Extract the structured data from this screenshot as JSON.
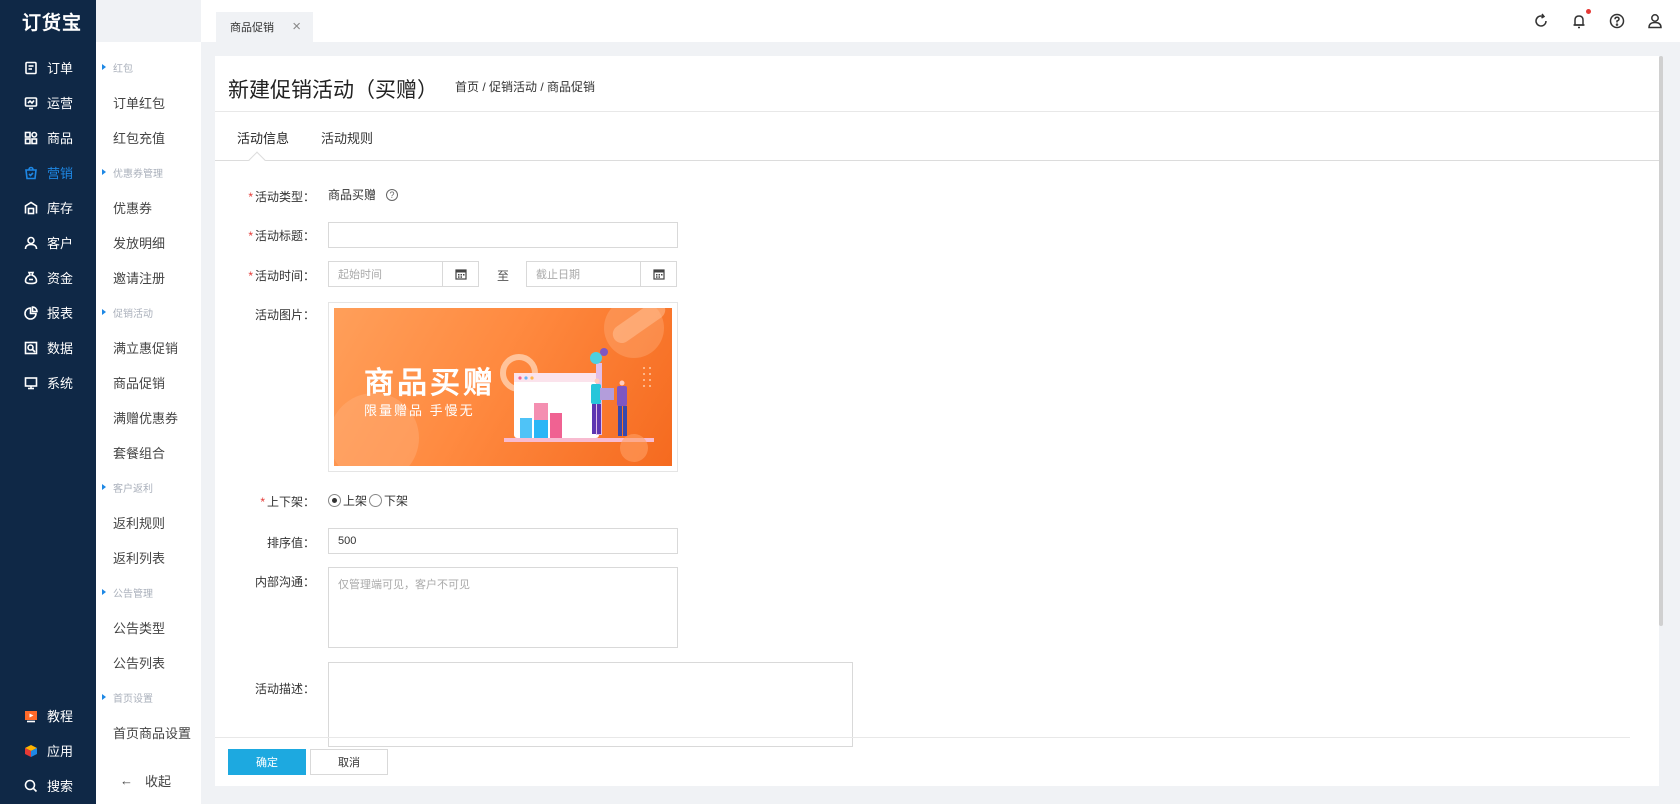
{
  "app": {
    "logo": "订货宝"
  },
  "nav": {
    "items": [
      {
        "label": "订单",
        "icon": "order-icon"
      },
      {
        "label": "运营",
        "icon": "operation-icon"
      },
      {
        "label": "商品",
        "icon": "goods-icon"
      },
      {
        "label": "营销",
        "icon": "marketing-icon",
        "active": true
      },
      {
        "label": "库存",
        "icon": "warehouse-icon"
      },
      {
        "label": "客户",
        "icon": "customer-icon"
      },
      {
        "label": "资金",
        "icon": "money-icon"
      },
      {
        "label": "报表",
        "icon": "report-icon"
      },
      {
        "label": "数据",
        "icon": "data-icon"
      },
      {
        "label": "系统",
        "icon": "system-icon"
      }
    ],
    "bottom": [
      {
        "label": "教程",
        "icon": "tutorial-icon"
      },
      {
        "label": "应用",
        "icon": "app-icon"
      },
      {
        "label": "搜索",
        "icon": "search-icon"
      }
    ]
  },
  "subnav": {
    "groups": [
      {
        "head": "红包",
        "items": [
          "订单红包",
          "红包充值"
        ]
      },
      {
        "head": "优惠券管理",
        "items": [
          "优惠券",
          "发放明细",
          "邀请注册"
        ]
      },
      {
        "head": "促销活动",
        "items": [
          "满立惠促销",
          "商品促销",
          "满赠优惠券",
          "套餐组合"
        ]
      },
      {
        "head": "客户返利",
        "items": [
          "返利规则",
          "返利列表"
        ]
      },
      {
        "head": "公告管理",
        "items": [
          "公告类型",
          "公告列表"
        ]
      },
      {
        "head": "首页设置",
        "items": [
          "首页商品设置"
        ]
      }
    ],
    "collapse_label": "收起"
  },
  "topbar": {
    "tab_label": "商品促销"
  },
  "page": {
    "title": "新建促销活动（买赠）",
    "breadcrumb": "首页 / 促销活动 / 商品促销",
    "tabs": [
      "活动信息",
      "活动规则"
    ]
  },
  "form": {
    "type_label": "活动类型：",
    "type_value": "商品买赠",
    "title_label": "活动标题：",
    "title_value": "",
    "time_label": "活动时间：",
    "start_placeholder": "起始时间",
    "to_text": "至",
    "end_placeholder": "截止日期",
    "image_label": "活动图片：",
    "banner_title": "商品买赠",
    "banner_sub": "限量赠品 手慢无",
    "shelf_label": "上下架：",
    "shelf_on": "上架",
    "shelf_off": "下架",
    "shelf_selected": "上架",
    "sort_label": "排序值：",
    "sort_value": "500",
    "internal_label": "内部沟通：",
    "internal_placeholder": "仅管理端可见，客户不可见",
    "desc_label": "活动描述：",
    "desc_value": ""
  },
  "buttons": {
    "ok": "确定",
    "cancel": "取消"
  }
}
